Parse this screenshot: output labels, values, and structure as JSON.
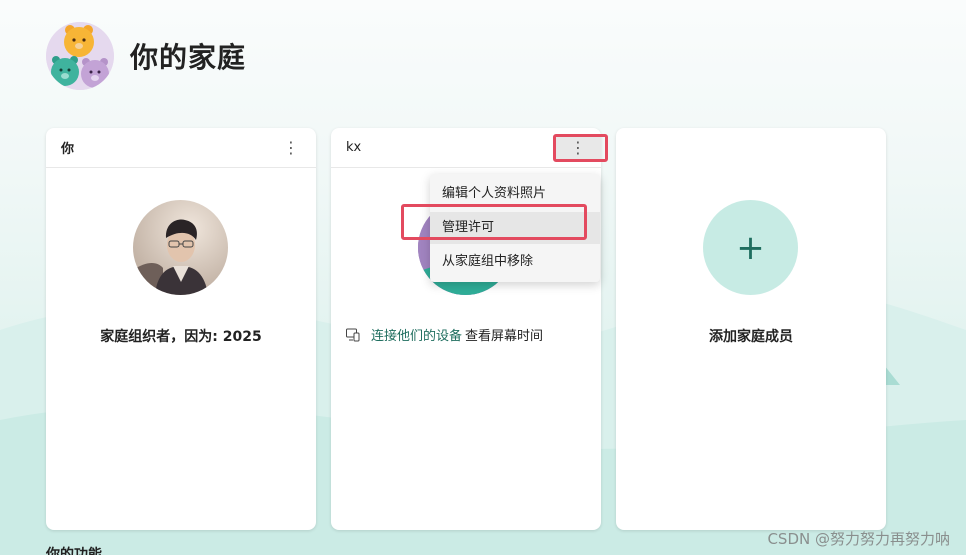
{
  "header": {
    "title": "你的家庭",
    "avatar_icon": "bears-family-icon"
  },
  "cards": {
    "you": {
      "name": "你",
      "caption": "家庭组织者，因为: 2025"
    },
    "kx": {
      "name": "kx",
      "device_link": "连接他们的设备",
      "device_rest": "查看屏幕时间",
      "menu": [
        "编辑个人资料照片",
        "管理许可",
        "从家庭组中移除"
      ]
    },
    "add": {
      "label": "添加家庭成员",
      "plus": "+"
    }
  },
  "more_glyph": "⋮",
  "section_title": "你的功能",
  "watermark": "CSDN @努力努力再努力呐",
  "colors": {
    "accent": "#1f6e5f",
    "add_bg": "#c7ebe4",
    "highlight": "#e34a5f"
  }
}
